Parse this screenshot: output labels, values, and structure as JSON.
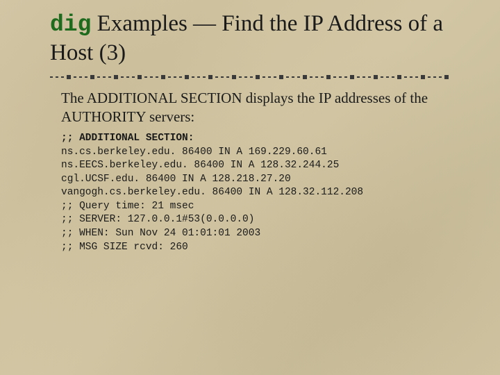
{
  "title": {
    "command": "dig",
    "rest": " Examples — Find the IP Address of a Host (3)"
  },
  "intro": "The ADDITIONAL SECTION displays the IP addresses of the AUTHORITY servers:",
  "code": {
    "header": ";; ADDITIONAL SECTION:",
    "records": [
      "ns.cs.berkeley.edu. 86400 IN A 169.229.60.61",
      "ns.EECS.berkeley.edu. 86400 IN A 128.32.244.25",
      "cgl.UCSF.edu. 86400 IN A 128.218.27.20",
      "vangogh.cs.berkeley.edu. 86400 IN A 128.32.112.208"
    ],
    "footer": [
      ";; Query time: 21 msec",
      ";; SERVER: 127.0.0.1#53(0.0.0.0)",
      ";; WHEN: Sun Nov 24 01:01:01 2003",
      ";; MSG SIZE rcvd: 260"
    ]
  }
}
